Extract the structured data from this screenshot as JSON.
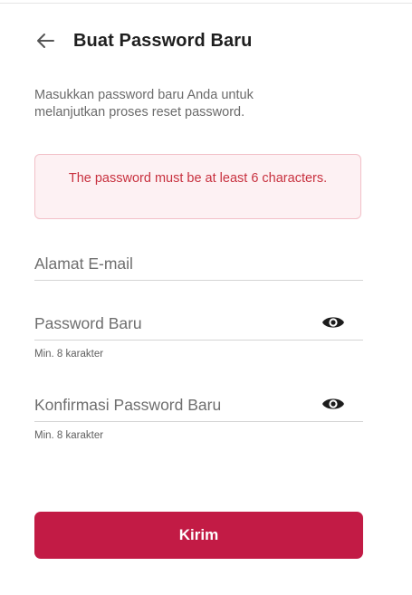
{
  "header": {
    "back_icon": "arrow-left-icon",
    "title": "Buat Password Baru"
  },
  "subtitle": "Masukkan password baru Anda untuk melanjutkan proses reset password.",
  "alert": {
    "message": "The password must be at least 6 characters.",
    "color": "#c8313f",
    "background": "#fdf1f3"
  },
  "form": {
    "email": {
      "placeholder": "Alamat E-mail",
      "value": ""
    },
    "password": {
      "placeholder": "Password Baru",
      "value": "",
      "hint": "Min. 8 karakter",
      "toggle_icon": "eye-icon"
    },
    "confirm": {
      "placeholder": "Konfirmasi Password Baru",
      "value": "",
      "hint": "Min. 8 karakter",
      "toggle_icon": "eye-icon"
    }
  },
  "submit": {
    "label": "Kirim",
    "color": "#c21b45"
  }
}
